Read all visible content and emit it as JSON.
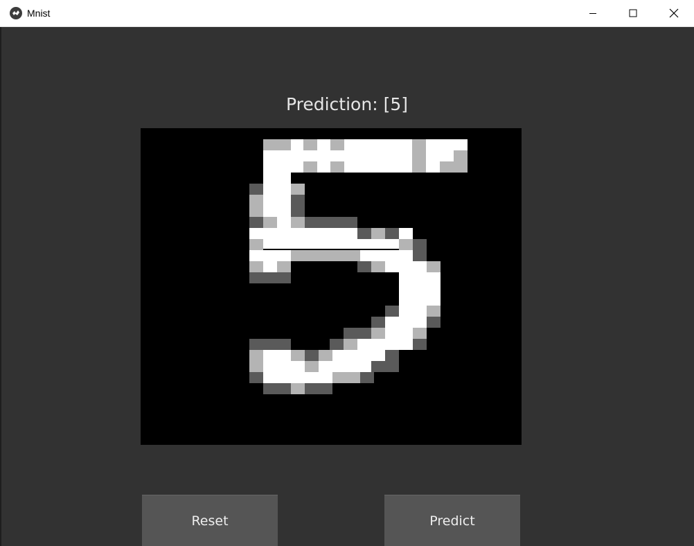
{
  "window": {
    "title": "Mnist",
    "icon": "kivy-logo-icon",
    "controls": [
      "minimize-icon",
      "maximize-icon",
      "close-icon"
    ]
  },
  "prediction": {
    "text": "Prediction: [5]"
  },
  "drawing_canvas": {
    "content": "handwritten digit 5 (pixelated)",
    "colors": {
      "background": "#000000",
      "stroke": "#ffffff",
      "edge_light": "#b4b4b4",
      "edge_dark": "#5a5a5a"
    }
  },
  "buttons": {
    "reset_label": "Reset",
    "predict_label": "Predict"
  },
  "colors": {
    "app_background": "#323232",
    "button_background": "#555555",
    "titlebar_background": "#ffffff"
  }
}
